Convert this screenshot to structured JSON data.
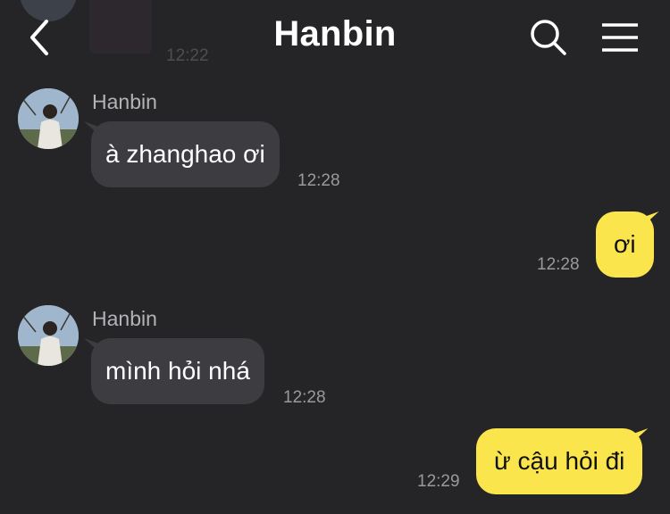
{
  "header": {
    "title": "Hanbin",
    "back_icon": "chevron-left-icon",
    "search_icon": "search-icon",
    "menu_icon": "menu-icon"
  },
  "previous_message": {
    "time": "12:22"
  },
  "messages": [
    {
      "direction": "incoming",
      "sender": "Hanbin",
      "text": "à zhanghao ơi",
      "time": "12:28"
    },
    {
      "direction": "outgoing",
      "text": "ơi",
      "time": "12:28"
    },
    {
      "direction": "incoming",
      "sender": "Hanbin",
      "text": "mình hỏi nhá",
      "time": "12:28"
    },
    {
      "direction": "outgoing",
      "text": "ừ cậu hỏi đi",
      "time": "12:29"
    }
  ],
  "colors": {
    "background": "#252528",
    "incoming_bubble": "#3d3d41",
    "outgoing_bubble": "#fae64c",
    "timestamp": "#9a9a9e"
  }
}
